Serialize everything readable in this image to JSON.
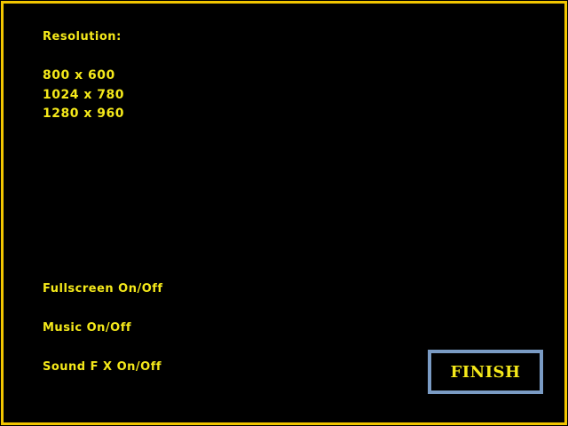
{
  "colors": {
    "background": "#000000",
    "frame_border": "#f2c500",
    "text": "#f5e91a",
    "finish_border": "#7a9bc4"
  },
  "settings": {
    "resolution_heading": "Resolution:",
    "resolutions": [
      "800 x 600",
      "1024 x 780",
      "1280 x 960"
    ],
    "fullscreen_label": "Fullscreen On/Off",
    "music_label": "Music On/Off",
    "sound_fx_label": "Sound F X On/Off",
    "finish_label": "FINISH"
  }
}
